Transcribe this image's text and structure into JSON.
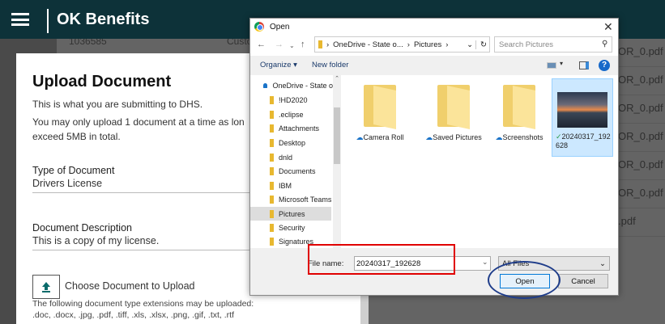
{
  "app": {
    "brand": "OK Benefits"
  },
  "background": {
    "record_number": "1036585",
    "column_partial": "Custo",
    "rows": [
      "OR_0.pdf",
      "OR_0.pdf",
      "OR_0.pdf",
      "OR_0.pdf",
      "OR_0.pdf",
      "OR_0.pdf",
      ".pdf"
    ]
  },
  "modal": {
    "title": "Upload Document",
    "line1": "This is what you are submitting to DHS.",
    "line2": "You may only upload 1 document at a time as lon",
    "line3": "exceed 5MB in total.",
    "type_label": "Type of Document",
    "type_value": "Drivers License",
    "desc_label": "Document Description",
    "desc_value": "This is a copy of my license.",
    "choose_label": "Choose Document to Upload",
    "ext_line1": "The following document type extensions may be uploaded:",
    "ext_line2": ".doc, .docx, .jpg, .pdf, .tiff, .xls, .xlsx, .png, .gif, .txt, .rtf"
  },
  "dialog": {
    "title": "Open",
    "path": [
      "OneDrive - State o...",
      "Pictures"
    ],
    "search_placeholder": "Search Pictures",
    "organize": "Organize ▾",
    "new_folder": "New folder",
    "nav": [
      "OneDrive - State o",
      "!HD2020",
      ".eclipse",
      "Attachments",
      "Desktop",
      "dnld",
      "Documents",
      "IBM",
      "Microsoft Teams",
      "Pictures",
      "Security",
      "Signatures"
    ],
    "selected_nav": "Pictures",
    "items": [
      {
        "name": "Camera Roll",
        "type": "folder"
      },
      {
        "name": "Saved Pictures",
        "type": "folder"
      },
      {
        "name": "Screenshots",
        "type": "folder"
      },
      {
        "name": "20240317_192628",
        "type": "image",
        "selected": true
      }
    ],
    "file_name_label": "File name:",
    "file_name_value": "20240317_192628",
    "filter": "All Files",
    "open": "Open",
    "cancel": "Cancel"
  },
  "annotations": {
    "highlight_box_color": "#e00000",
    "circle_color": "#1f3d8a"
  }
}
